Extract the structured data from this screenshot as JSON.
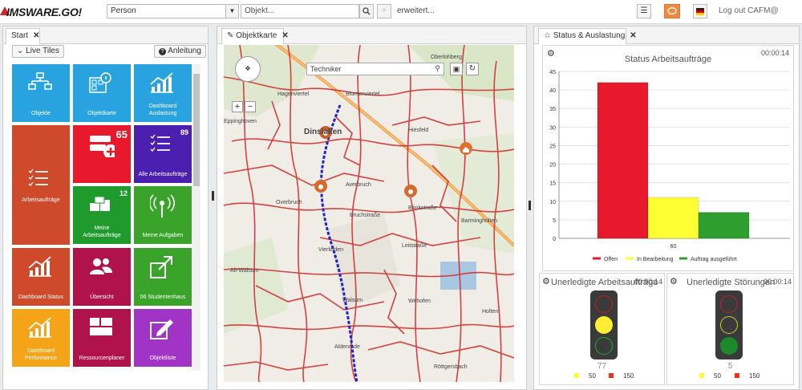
{
  "header": {
    "logo_text": "IMSWARE.GO!",
    "person_select": "Person",
    "object_placeholder": "Objekt...",
    "search_icon": "search-icon",
    "add_icon": "plus-icon",
    "advanced_link": "erweitert...",
    "menu_icon": "hamburger-icon",
    "chat_icon": "chat-icon",
    "flag_icon": "german-flag-icon",
    "logout_label": "Log out CAFM@",
    "accent_color": "#d9232a"
  },
  "start_panel": {
    "tab_label": "Start",
    "live_tiles_label": "Live Tiles",
    "guide_label": "Anleitung",
    "tiles": [
      {
        "label": "Objekte",
        "color": "#29a3e0",
        "icon": "hierarchy-icon"
      },
      {
        "label": "Objektkarte",
        "color": "#29a3e0",
        "icon": "object-card-icon"
      },
      {
        "label": "Dashboard Auslastung",
        "color": "#29a3e0",
        "icon": "chart-up-icon"
      },
      {
        "label": "Arbeitsaufträge",
        "color": "#cf4a2a",
        "icon": "task-list-icon"
      },
      {
        "label": "",
        "color": "#e8192c",
        "icon": "server-add-icon",
        "count": "65"
      },
      {
        "label": "Alle Arbeitsaufträge",
        "color": "#4b1fb0",
        "icon": "task-list-icon",
        "count": "89"
      },
      {
        "label": "Meine Arbeitsaufträge",
        "color": "#1f9a2d",
        "icon": "boxes-icon",
        "count": "12"
      },
      {
        "label": "Meine Aufgaben",
        "color": "#3aa32a",
        "icon": "antenna-icon"
      },
      {
        "label": "Dashboard Status",
        "color": "#cf4a2a",
        "icon": "chart-up-icon"
      },
      {
        "label": "Übersicht",
        "color": "#b0124a",
        "icon": "users-icon"
      },
      {
        "label": "06 Studentenhaus",
        "color": "#3aa32a",
        "icon": "external-link-icon"
      },
      {
        "label": "Dashboard Performance",
        "color": "#f5a418",
        "icon": "chart-up-icon"
      },
      {
        "label": "Ressourcenplaner",
        "color": "#b0124a",
        "icon": "grid-icon"
      },
      {
        "label": "Objektliste",
        "color": "#a233c7",
        "icon": "edit-icon"
      }
    ]
  },
  "map_panel": {
    "tab_label": "Objektkarte",
    "search_value": "Techniker",
    "zoom_in": "+",
    "zoom_out": "−",
    "labels": [
      "Oberlohberg",
      "Hagenviertel",
      "Blumenviertel",
      "Eppinghoven",
      "Dinslaken",
      "Hiesfeld",
      "Averbruch",
      "Overbruch",
      "Bruchstraße",
      "Barmingholten",
      "Vierlinden",
      "Alt-Walsum",
      "Walsum",
      "Wehofen",
      "Holten",
      "Aldenrade",
      "Röttgersbach",
      "Leitstraße",
      "Brinkstraße"
    ]
  },
  "status_panel": {
    "tab_label": "Status & Auslastung",
    "bar_card": {
      "title": "Status Arbeitsaufträge",
      "time": "00:00:14"
    },
    "light1": {
      "title": "Unerledigte Arbeitsaufträge",
      "time": "00:00:14",
      "value": "77",
      "legend_low": "50",
      "legend_high": "150",
      "active": "yellow"
    },
    "light2": {
      "title": "Unerledigte Störungen",
      "time": "00:00:14",
      "value": "5",
      "legend_low": "50",
      "legend_high": "150",
      "active": "green"
    }
  },
  "chart_data": {
    "type": "bar",
    "title": "Status Arbeitsaufträge",
    "categories": [
      "60"
    ],
    "series": [
      {
        "name": "Offen",
        "values": [
          42
        ],
        "color": "#e8192c"
      },
      {
        "name": "In Bearbeitung",
        "values": [
          11
        ],
        "color": "#ffff33"
      },
      {
        "name": "Auftrag ausgeführt",
        "values": [
          7
        ],
        "color": "#2e9e2e"
      }
    ],
    "yticks": [
      0,
      5,
      10,
      15,
      20,
      25,
      30,
      35,
      40,
      45
    ],
    "ylim": [
      0,
      45
    ],
    "grid": true,
    "legend": "bottom"
  }
}
